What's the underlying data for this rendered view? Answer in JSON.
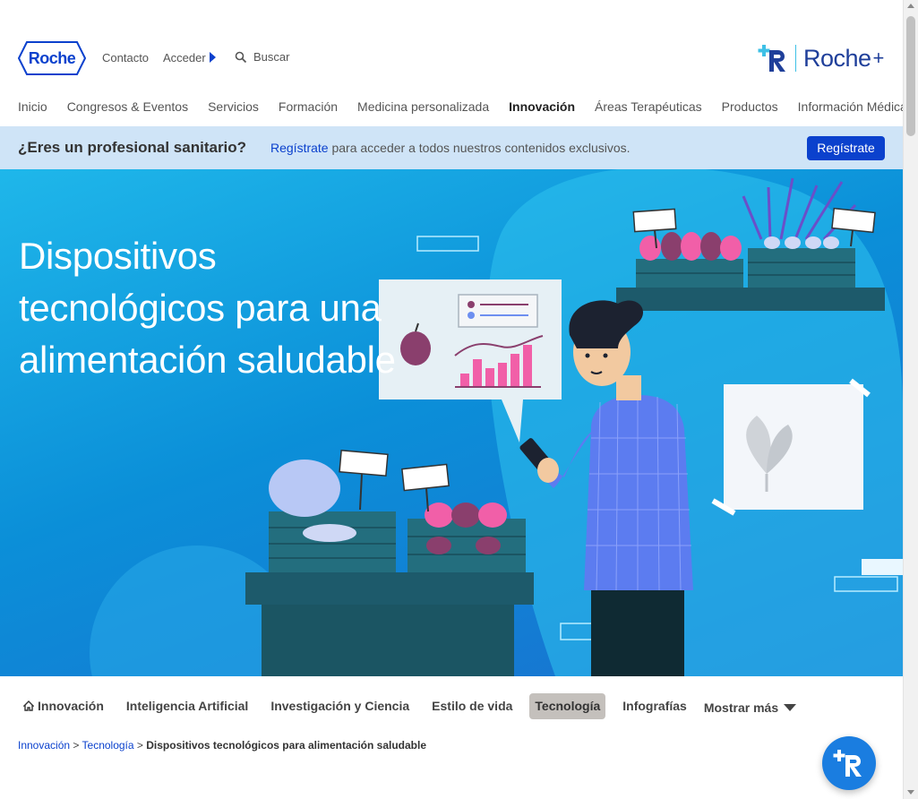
{
  "header": {
    "logo_text": "Roche",
    "contacto": "Contacto",
    "acceder": "Acceder",
    "search_label": "Buscar",
    "roche_plus": "Roche",
    "roche_plus_suffix": "+"
  },
  "main_nav": [
    {
      "label": "Inicio",
      "active": false
    },
    {
      "label": "Congresos & Eventos",
      "active": false
    },
    {
      "label": "Servicios",
      "active": false
    },
    {
      "label": "Formación",
      "active": false
    },
    {
      "label": "Medicina personalizada",
      "active": false
    },
    {
      "label": "Innovación",
      "active": true
    },
    {
      "label": "Áreas Terapéuticas",
      "active": false
    },
    {
      "label": "Productos",
      "active": false
    },
    {
      "label": "Información Médica",
      "active": false
    }
  ],
  "pro_banner": {
    "question": "¿Eres un profesional sanitario?",
    "link": "Regístrate",
    "text": " para acceder a todos nuestros contenidos exclusivos.",
    "button": "Regístrate"
  },
  "hero": {
    "title_lines": [
      "Dispositivos",
      "tecnológicos para una",
      "alimentación saludable"
    ]
  },
  "sub_nav": {
    "items": [
      {
        "label": "Innovación",
        "active": false,
        "home": true
      },
      {
        "label": "Inteligencia Artificial",
        "active": false
      },
      {
        "label": "Investigación y Ciencia",
        "active": false
      },
      {
        "label": "Estilo de vida",
        "active": false
      },
      {
        "label": "Tecnología",
        "active": true
      },
      {
        "label": "Infografías",
        "active": false
      }
    ],
    "more": "Mostrar más"
  },
  "breadcrumb": {
    "items": [
      "Innovación",
      "Tecnología"
    ],
    "separator": " > ",
    "current": "Dispositivos tecnológicos para alimentación saludable"
  },
  "colors": {
    "brand_blue": "#0b41cd",
    "banner_bg": "#cfe4f7",
    "active_tab_bg": "#c4c0bc",
    "fab": "#1a7de0"
  },
  "icons": [
    "search-icon",
    "home-icon",
    "chevron-down-icon",
    "caret-right-icon",
    "roche-plus-icon"
  ]
}
